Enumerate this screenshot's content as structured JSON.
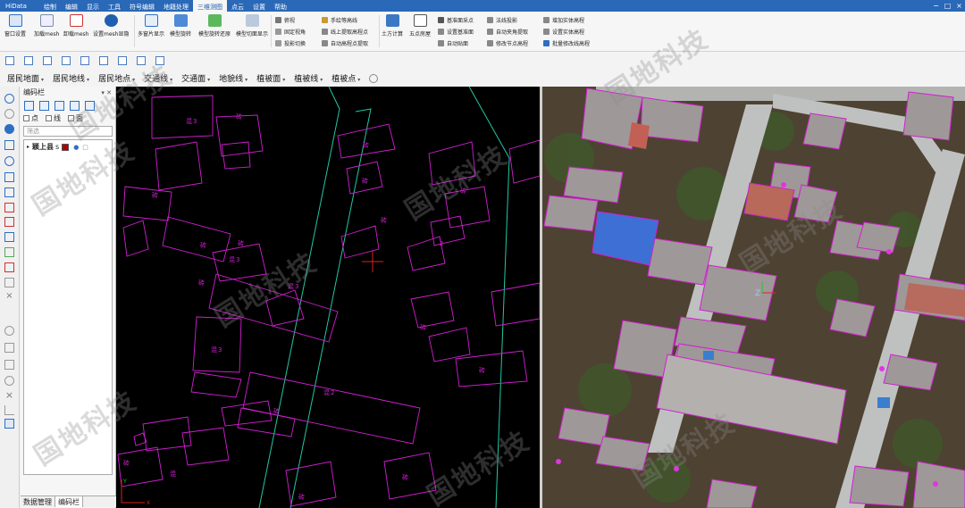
{
  "app": {
    "title": "HiData"
  },
  "menu": [
    "绘制",
    "编辑",
    "显示",
    "工具",
    "符号编辑",
    "地籍处理",
    "三维测图",
    "点云",
    "设置",
    "帮助"
  ],
  "menu_active": "三维测图",
  "ribbon": {
    "large_buttons": [
      "窗口设置",
      "加载mesh",
      "卸载mesh",
      "设置mesh显隐",
      "多窗片显示",
      "模型旋转",
      "模型旋转还原",
      "模型切面显示",
      "土方计算",
      "五点房屋"
    ],
    "mesh_badge": "mesh",
    "group_view": [
      "俯视",
      "固定视角",
      "投影切换"
    ],
    "group_contour": [
      "手绘等高线",
      "线上提取高程点",
      "自动高程点提取"
    ],
    "group_surface": [
      "基准面采点",
      "设置基准面",
      "自动贴面"
    ],
    "group_projection": [
      "法线投影",
      "自动夹角提取",
      "修改节点高程"
    ],
    "group_solid": [
      "增加实体高程",
      "设置实体高程",
      "批量修改线高程"
    ]
  },
  "layer_toolbar": [
    "居民地面",
    "居民地线",
    "居民地点",
    "交通线",
    "交通面",
    "地貌线",
    "植被面",
    "植被线",
    "植被点"
  ],
  "code_panel": {
    "title": "编码栏",
    "pin_icon": "pin-icon",
    "filter": {
      "point": "点",
      "line": "线",
      "area": "面"
    },
    "search_placeholder": "筛选",
    "tree_root": "颖上县",
    "tree_suffix": "s",
    "tabs": [
      "数据管理",
      "编码栏"
    ]
  },
  "map": {
    "labels_brick": "砖",
    "labels_mixed": "混",
    "floor_3": "3",
    "floor_2": "2",
    "axis_y": "Y",
    "axis_x": "X",
    "cursor_z": "Z"
  },
  "watermark": "国地科技",
  "colors": {
    "accent": "#2a68b8",
    "vector_building": "#d21fd2",
    "road_line": "#22c8a4",
    "axis": "#d22"
  }
}
